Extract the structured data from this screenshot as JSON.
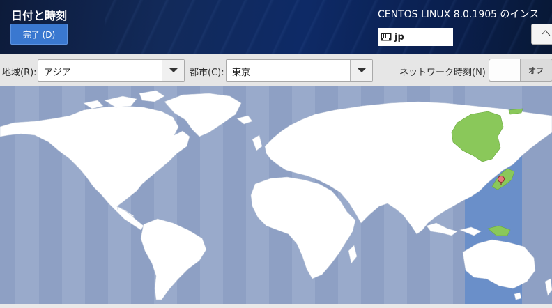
{
  "header": {
    "title": "日付と時刻",
    "done_label": "完了 (D)",
    "product": "CENTOS LINUX 8.0.1905 のインス",
    "keyboard_layout": "jp",
    "help_label": "ヘ"
  },
  "toolbar": {
    "region_label": "地域(R):",
    "region_value": "アジア",
    "city_label": "都市(C):",
    "city_value": "東京",
    "ntp_label": "ネットワーク時刻(N)",
    "ntp_state": "オフ"
  },
  "map": {
    "ocean_color": "#99aacb",
    "land_color": "#ffffff",
    "selected_zone_color": "#6a8fc9",
    "selected_region_color": "#8ac85a",
    "marker_color": "#e57a7a",
    "selected_timezone": "Asia/Tokyo"
  }
}
